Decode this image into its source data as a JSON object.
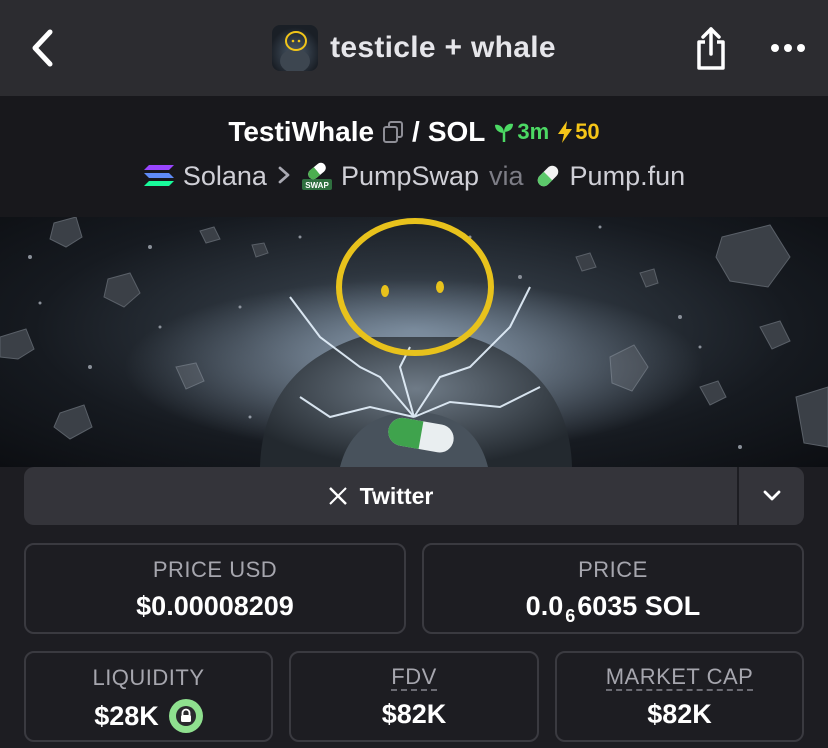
{
  "nav": {
    "title": "testicle + whale",
    "icons": {
      "back": "chevron-left-icon",
      "share": "share-icon",
      "more": "more-dots-icon"
    }
  },
  "pair": {
    "base": "TestiWhale",
    "separator": "/",
    "quote": "SOL",
    "age": "3m",
    "boosts": "50",
    "colors": {
      "age": "#4cd964",
      "boost": "#f5c518"
    }
  },
  "route": {
    "chain": "Solana",
    "dex": "PumpSwap",
    "via": "via",
    "launchpad": "Pump.fun"
  },
  "social": {
    "twitter_label": "Twitter"
  },
  "stats": {
    "price_usd": {
      "label": "PRICE USD",
      "value": "$0.00008209"
    },
    "price_native": {
      "label": "PRICE",
      "prefix": "0.0",
      "zeros": "6",
      "rest": "6035 SOL"
    },
    "liquidity": {
      "label": "LIQUIDITY",
      "value": "$28K"
    },
    "fdv": {
      "label": "FDV",
      "value": "$82K"
    },
    "market_cap": {
      "label": "MARKET CAP",
      "value": "$82K"
    }
  }
}
